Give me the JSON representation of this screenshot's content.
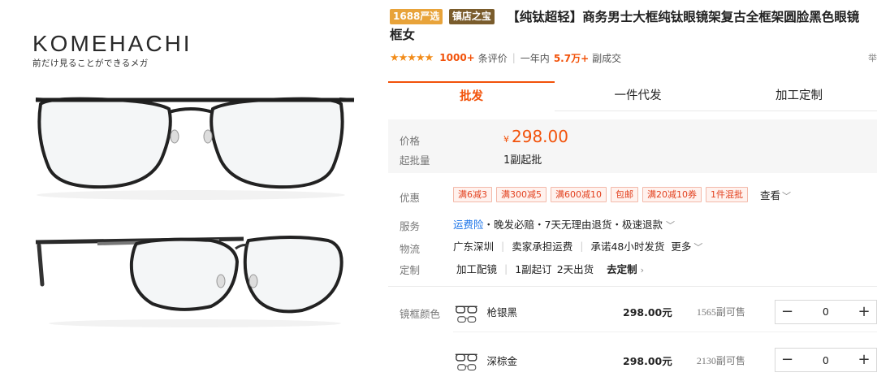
{
  "gallery": {
    "brand": "KOMEHACHI",
    "tagline": "前だけ見ることができるメガ"
  },
  "product": {
    "badges": [
      "1688严选",
      "镇店之宝"
    ],
    "title": "【纯钛超轻】商务男士大框纯钛眼镜架复古全框架圆脸黑色眼镜框女",
    "rating_stars": "★★★★★",
    "review_count": "1000+",
    "review_label": "条评价",
    "sales_period": "一年内",
    "sales_count": "5.7万+",
    "sales_label": "副成交",
    "report_label": "举"
  },
  "tabs": [
    {
      "label": "批发",
      "active": true
    },
    {
      "label": "一件代发",
      "active": false
    },
    {
      "label": "加工定制",
      "active": false
    }
  ],
  "pricing": {
    "price_label": "价格",
    "currency": "¥",
    "price": "298.00",
    "moq_label": "起批量",
    "moq": "1副起批"
  },
  "promotions": {
    "label": "优惠",
    "coupons": [
      "满6减3",
      "满300减5",
      "满600减10",
      "包邮",
      "满20减10券",
      "1件混批"
    ],
    "see_all": "查看"
  },
  "service": {
    "label": "服务",
    "link": "运费险",
    "items": "・晚发必赔・7天无理由退货・极速退款"
  },
  "logistics": {
    "label": "物流",
    "origin": "广东深圳",
    "shipping": "卖家承担运费",
    "promise": "承诺48小时发货",
    "more": "更多"
  },
  "customize": {
    "label": "定制",
    "service": "加工配镜",
    "moq": "1副起订",
    "lead_time": "2天出货",
    "link": "去定制"
  },
  "sku": {
    "label": "镜框颜色",
    "rows": [
      {
        "name": "枪银黑",
        "price": "298.00元",
        "stock": "1565副可售",
        "qty": "0"
      },
      {
        "name": "深棕金",
        "price": "298.00元",
        "stock": "2130副可售",
        "qty": "0"
      }
    ]
  },
  "colors": {
    "accent": "#f2520a",
    "badge_orange": "#e8a33a",
    "badge_brown": "#7a5c2c",
    "link_blue": "#1a73e8",
    "coupon_red": "#e2401e"
  }
}
